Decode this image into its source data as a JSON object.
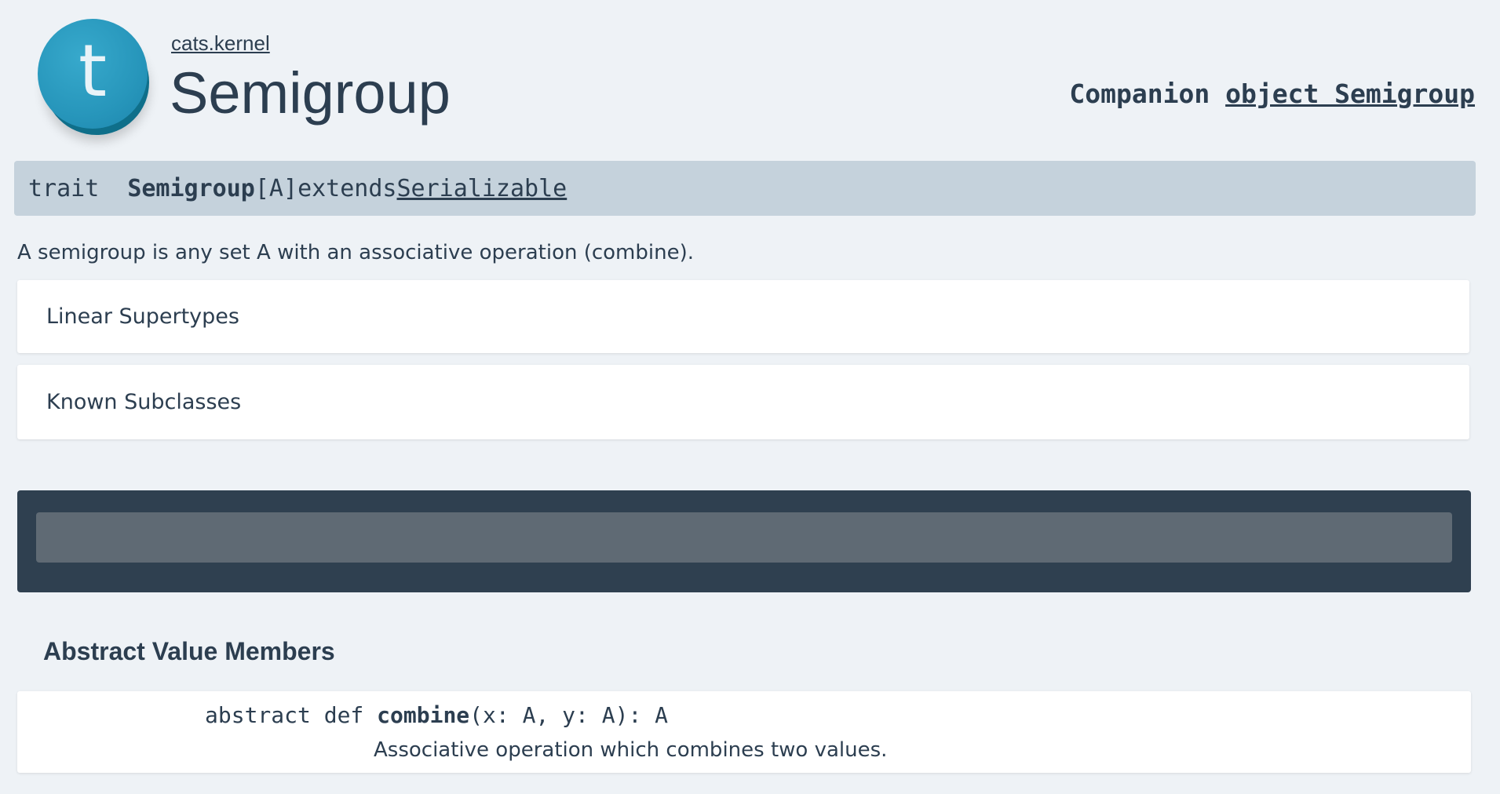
{
  "header": {
    "logo_letter": "t",
    "package": "cats.kernel",
    "title": "Semigroup",
    "companion_label": "Companion",
    "companion_link": "object Semigroup"
  },
  "signature": {
    "keyword": "trait",
    "name": "Semigroup",
    "type_params": "[A]",
    "extends_kw": "extends",
    "parent": "Serializable"
  },
  "description": "A semigroup is any set A with an associative operation (combine).",
  "panels": {
    "linear_supertypes": "Linear Supertypes",
    "known_subclasses": "Known Subclasses"
  },
  "filter": {
    "value": ""
  },
  "members": {
    "section_title": "Abstract Value Members",
    "items": [
      {
        "modifiers": "abstract def ",
        "name": "combine",
        "params": "(x: A, y: A): A",
        "doc": "Associative operation which combines two values."
      }
    ]
  },
  "colors": {
    "background": "#eef2f6",
    "logo": "#2796bb",
    "signature_bar": "#c5d2dc",
    "filter_panel": "#2f4050",
    "filter_input": "#5f6a74",
    "text": "#2c3e50"
  },
  "icons": {
    "logo": "trait-t-icon"
  }
}
